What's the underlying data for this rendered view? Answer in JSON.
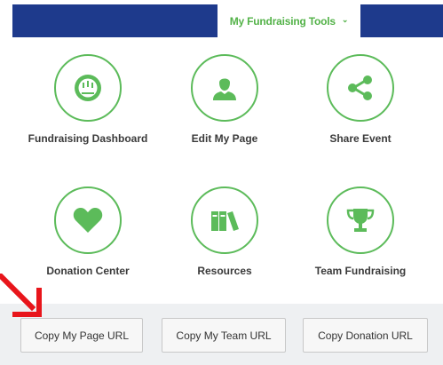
{
  "menu": {
    "label": "My Fundraising Tools"
  },
  "tools": [
    {
      "label": "Fundraising Dashboard",
      "icon": "dashboard-icon"
    },
    {
      "label": "Edit My Page",
      "icon": "user-icon"
    },
    {
      "label": "Share Event",
      "icon": "share-icon"
    },
    {
      "label": "Donation Center",
      "icon": "heart-icon"
    },
    {
      "label": "Resources",
      "icon": "books-icon"
    },
    {
      "label": "Team Fundraising",
      "icon": "trophy-icon"
    }
  ],
  "buttons": {
    "copy_page_url": "Copy My Page URL",
    "copy_team_url": "Copy My Team URL",
    "copy_donation_url": "Copy Donation URL"
  },
  "colors": {
    "header_blue": "#1e3a8c",
    "accent_green": "#53b248",
    "annotation_red": "#e8151b"
  }
}
